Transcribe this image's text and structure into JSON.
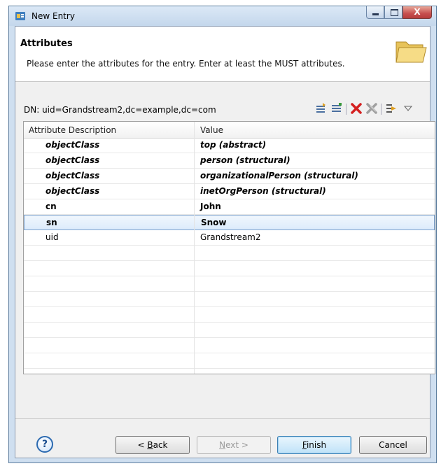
{
  "window": {
    "title": "New Entry",
    "close_glyph": "X"
  },
  "page": {
    "heading": "Attributes",
    "description": "Please enter the attributes for the entry. Enter at least the MUST attributes."
  },
  "dn": {
    "label": "DN: uid=Grandstream2,dc=example,dc=com"
  },
  "table": {
    "headers": [
      "Attribute Description",
      "Value"
    ],
    "rows": [
      {
        "attr": "objectClass",
        "value": "top (abstract)"
      },
      {
        "attr": "objectClass",
        "value": "person (structural)"
      },
      {
        "attr": "objectClass",
        "value": "organizationalPerson (structural)"
      },
      {
        "attr": "objectClass",
        "value": "inetOrgPerson (structural)"
      },
      {
        "attr": "cn",
        "value": "John"
      },
      {
        "attr": "sn",
        "value": "Snow"
      },
      {
        "attr": "uid",
        "value": "Grandstream2"
      }
    ]
  },
  "buttons": {
    "help": "?",
    "back_mnemonic": "B",
    "back_rest": "ack",
    "back_prefix": "< ",
    "next_mnemonic": "N",
    "next_rest": "ext >",
    "finish_mnemonic": "F",
    "finish_rest": "inish",
    "cancel": "Cancel"
  },
  "icons": [
    "new-attribute-icon",
    "new-value-icon",
    "delete-icon",
    "delete-all-icon",
    "edit-value-icon",
    "view-menu-icon"
  ],
  "colors": {
    "title_bar": "#c4d7ec",
    "selection": "#dcebfc",
    "close_button": "#c75050"
  }
}
